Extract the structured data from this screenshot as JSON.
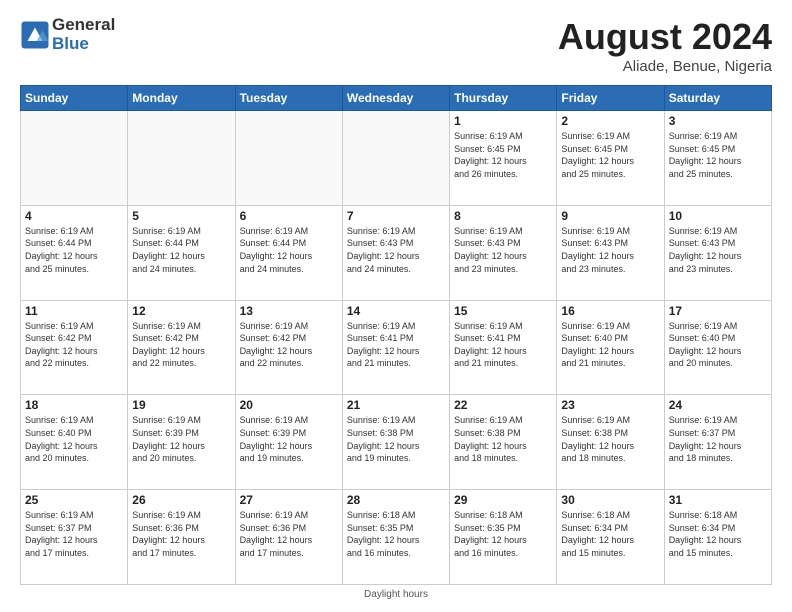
{
  "header": {
    "logo_line1": "General",
    "logo_line2": "Blue",
    "month_title": "August 2024",
    "location": "Aliade, Benue, Nigeria"
  },
  "weekdays": [
    "Sunday",
    "Monday",
    "Tuesday",
    "Wednesday",
    "Thursday",
    "Friday",
    "Saturday"
  ],
  "footer": {
    "daylight_label": "Daylight hours"
  },
  "weeks": [
    [
      {
        "day": "",
        "info": ""
      },
      {
        "day": "",
        "info": ""
      },
      {
        "day": "",
        "info": ""
      },
      {
        "day": "",
        "info": ""
      },
      {
        "day": "1",
        "info": "Sunrise: 6:19 AM\nSunset: 6:45 PM\nDaylight: 12 hours\nand 26 minutes."
      },
      {
        "day": "2",
        "info": "Sunrise: 6:19 AM\nSunset: 6:45 PM\nDaylight: 12 hours\nand 25 minutes."
      },
      {
        "day": "3",
        "info": "Sunrise: 6:19 AM\nSunset: 6:45 PM\nDaylight: 12 hours\nand 25 minutes."
      }
    ],
    [
      {
        "day": "4",
        "info": "Sunrise: 6:19 AM\nSunset: 6:44 PM\nDaylight: 12 hours\nand 25 minutes."
      },
      {
        "day": "5",
        "info": "Sunrise: 6:19 AM\nSunset: 6:44 PM\nDaylight: 12 hours\nand 24 minutes."
      },
      {
        "day": "6",
        "info": "Sunrise: 6:19 AM\nSunset: 6:44 PM\nDaylight: 12 hours\nand 24 minutes."
      },
      {
        "day": "7",
        "info": "Sunrise: 6:19 AM\nSunset: 6:43 PM\nDaylight: 12 hours\nand 24 minutes."
      },
      {
        "day": "8",
        "info": "Sunrise: 6:19 AM\nSunset: 6:43 PM\nDaylight: 12 hours\nand 23 minutes."
      },
      {
        "day": "9",
        "info": "Sunrise: 6:19 AM\nSunset: 6:43 PM\nDaylight: 12 hours\nand 23 minutes."
      },
      {
        "day": "10",
        "info": "Sunrise: 6:19 AM\nSunset: 6:43 PM\nDaylight: 12 hours\nand 23 minutes."
      }
    ],
    [
      {
        "day": "11",
        "info": "Sunrise: 6:19 AM\nSunset: 6:42 PM\nDaylight: 12 hours\nand 22 minutes."
      },
      {
        "day": "12",
        "info": "Sunrise: 6:19 AM\nSunset: 6:42 PM\nDaylight: 12 hours\nand 22 minutes."
      },
      {
        "day": "13",
        "info": "Sunrise: 6:19 AM\nSunset: 6:42 PM\nDaylight: 12 hours\nand 22 minutes."
      },
      {
        "day": "14",
        "info": "Sunrise: 6:19 AM\nSunset: 6:41 PM\nDaylight: 12 hours\nand 21 minutes."
      },
      {
        "day": "15",
        "info": "Sunrise: 6:19 AM\nSunset: 6:41 PM\nDaylight: 12 hours\nand 21 minutes."
      },
      {
        "day": "16",
        "info": "Sunrise: 6:19 AM\nSunset: 6:40 PM\nDaylight: 12 hours\nand 21 minutes."
      },
      {
        "day": "17",
        "info": "Sunrise: 6:19 AM\nSunset: 6:40 PM\nDaylight: 12 hours\nand 20 minutes."
      }
    ],
    [
      {
        "day": "18",
        "info": "Sunrise: 6:19 AM\nSunset: 6:40 PM\nDaylight: 12 hours\nand 20 minutes."
      },
      {
        "day": "19",
        "info": "Sunrise: 6:19 AM\nSunset: 6:39 PM\nDaylight: 12 hours\nand 20 minutes."
      },
      {
        "day": "20",
        "info": "Sunrise: 6:19 AM\nSunset: 6:39 PM\nDaylight: 12 hours\nand 19 minutes."
      },
      {
        "day": "21",
        "info": "Sunrise: 6:19 AM\nSunset: 6:38 PM\nDaylight: 12 hours\nand 19 minutes."
      },
      {
        "day": "22",
        "info": "Sunrise: 6:19 AM\nSunset: 6:38 PM\nDaylight: 12 hours\nand 18 minutes."
      },
      {
        "day": "23",
        "info": "Sunrise: 6:19 AM\nSunset: 6:38 PM\nDaylight: 12 hours\nand 18 minutes."
      },
      {
        "day": "24",
        "info": "Sunrise: 6:19 AM\nSunset: 6:37 PM\nDaylight: 12 hours\nand 18 minutes."
      }
    ],
    [
      {
        "day": "25",
        "info": "Sunrise: 6:19 AM\nSunset: 6:37 PM\nDaylight: 12 hours\nand 17 minutes."
      },
      {
        "day": "26",
        "info": "Sunrise: 6:19 AM\nSunset: 6:36 PM\nDaylight: 12 hours\nand 17 minutes."
      },
      {
        "day": "27",
        "info": "Sunrise: 6:19 AM\nSunset: 6:36 PM\nDaylight: 12 hours\nand 17 minutes."
      },
      {
        "day": "28",
        "info": "Sunrise: 6:18 AM\nSunset: 6:35 PM\nDaylight: 12 hours\nand 16 minutes."
      },
      {
        "day": "29",
        "info": "Sunrise: 6:18 AM\nSunset: 6:35 PM\nDaylight: 12 hours\nand 16 minutes."
      },
      {
        "day": "30",
        "info": "Sunrise: 6:18 AM\nSunset: 6:34 PM\nDaylight: 12 hours\nand 15 minutes."
      },
      {
        "day": "31",
        "info": "Sunrise: 6:18 AM\nSunset: 6:34 PM\nDaylight: 12 hours\nand 15 minutes."
      }
    ]
  ]
}
